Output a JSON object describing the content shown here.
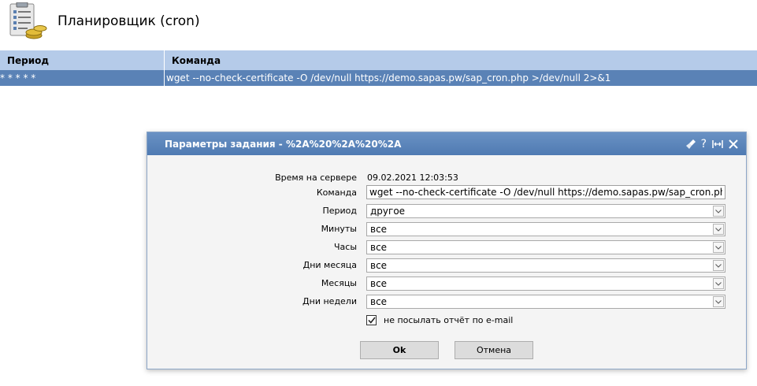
{
  "header": {
    "title": "Планировщик (cron)",
    "icon": "clipboard-coins-icon"
  },
  "table": {
    "columns": [
      "Период",
      "Команда"
    ],
    "rows": [
      {
        "period": "* * * * *",
        "command": "wget --no-check-certificate -O /dev/null https://demo.sapas.pw/sap_cron.php >/dev/null 2>&1"
      }
    ]
  },
  "dialog": {
    "title": "Параметры задания - %2A%20%2A%20%2A",
    "buttons": {
      "broom": "broom-icon",
      "help": "?",
      "maximize": "maximize-icon",
      "close": "close-icon"
    },
    "server_time_label": "Время на сервере",
    "server_time": "09.02.2021 12:03:53",
    "command_label": "Команда",
    "command_value": "wget --no-check-certificate -O /dev/null https://demo.sapas.pw/sap_cron.php",
    "period_label": "Период",
    "period_value": "другое",
    "minutes_label": "Минуты",
    "minutes_value": "все",
    "hours_label": "Часы",
    "hours_value": "все",
    "days_label": "Дни месяца",
    "days_value": "все",
    "months_label": "Месяцы",
    "months_value": "все",
    "weekdays_label": "Дни недели",
    "weekdays_value": "все",
    "no_email_label": "не посылать отчёт по e-mail",
    "no_email_checked": true,
    "ok_label": "Ok",
    "cancel_label": "Отмена"
  }
}
